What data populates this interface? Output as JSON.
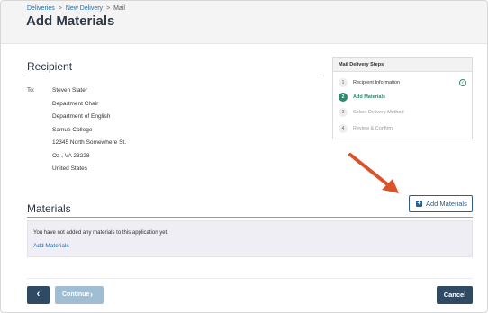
{
  "breadcrumb": {
    "items": [
      "Deliveries",
      "New Delivery",
      "Mail"
    ],
    "separator": ">"
  },
  "page": {
    "title": "Add Materials"
  },
  "recipient": {
    "heading": "Recipient",
    "to_label": "To:",
    "address": [
      "Steven Slater",
      "Department Chair",
      "Department of English",
      "Samue College",
      "12345 North Somewhere St.",
      "Oz , VA 23228",
      "United States"
    ]
  },
  "steps": {
    "heading": "Mail Delivery Steps",
    "items": [
      {
        "num": "1",
        "label": "Recipient Information",
        "state": "done"
      },
      {
        "num": "2",
        "label": "Add Materials",
        "state": "active"
      },
      {
        "num": "3",
        "label": "Select Delivery Method",
        "state": "pending"
      },
      {
        "num": "4",
        "label": "Review & Confirm",
        "state": "pending"
      }
    ]
  },
  "materials": {
    "heading": "Materials",
    "add_button_label": "Add Materials",
    "empty_message": "You have not added any materials to this application yet.",
    "add_link": "Add Materials"
  },
  "footer": {
    "back_icon": "‹",
    "continue_label": "Continue",
    "continue_icon": "›",
    "cancel_label": "Cancel"
  },
  "colors": {
    "primary": "#2f4a63",
    "accent_green": "#2f8a6c",
    "link": "#1f6fa8",
    "annotation_arrow": "#d9542b"
  },
  "icons": {
    "check": "check-circle-icon",
    "plus": "plus-square-icon"
  }
}
